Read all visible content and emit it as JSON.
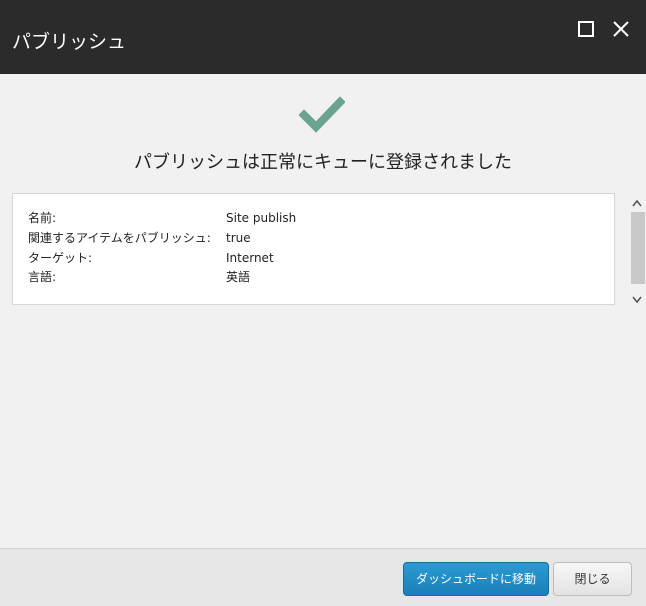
{
  "dialog": {
    "title": "パブリッシュ",
    "maximize_icon": "maximize-icon",
    "close_icon": "close-icon"
  },
  "status": {
    "icon": "checkmark-icon",
    "icon_color": "#6aa38e",
    "message": "パブリッシュは正常にキューに登録されました"
  },
  "details": [
    {
      "label": "名前:",
      "value": "Site publish"
    },
    {
      "label": "関連するアイテムをパブリッシュ:",
      "value": "true"
    },
    {
      "label": "ターゲット:",
      "value": "Internet"
    },
    {
      "label": "言語:",
      "value": "英語"
    }
  ],
  "footer": {
    "primary_label": "ダッシュボードに移動",
    "secondary_label": "閉じる"
  },
  "colors": {
    "titlebar": "#2b2b2b",
    "primary_button": "#1f8cc4"
  }
}
